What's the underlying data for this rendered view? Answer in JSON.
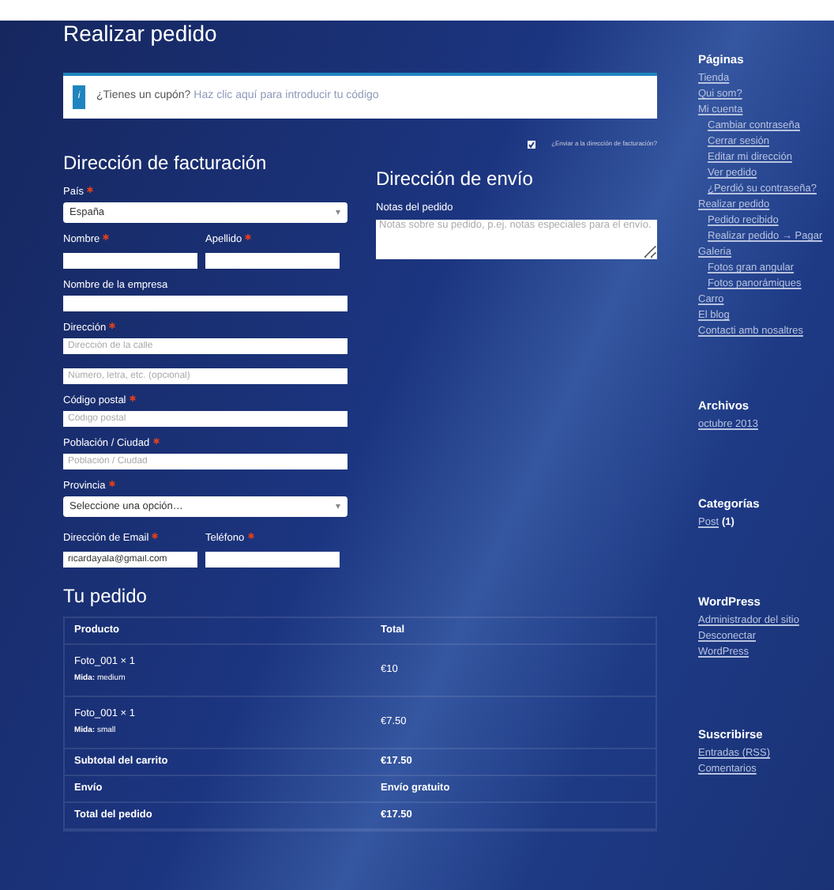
{
  "page_title": "Realizar pedido",
  "coupon": {
    "icon": "i",
    "text": "¿Tienes un cupón?",
    "link": "Haz clic aquí para introducir tu código"
  },
  "billing": {
    "heading": "Dirección de facturación",
    "fields": [
      {
        "kind": "select",
        "label": "País",
        "required": true,
        "value": "España"
      },
      {
        "kind": "pair",
        "items": [
          {
            "label": "Nombre",
            "required": true
          },
          {
            "label": "Apellido",
            "required": true
          }
        ]
      },
      {
        "kind": "text",
        "label": "Nombre de la empresa",
        "required": false
      },
      {
        "kind": "text",
        "label": "Dirección",
        "required": true,
        "placeholder": "Dirección de la calle"
      },
      {
        "kind": "text",
        "placeholder": "Número, letra, etc. (opcional)"
      },
      {
        "kind": "text",
        "label": "Código postal",
        "required": true,
        "placeholder": "Código postal"
      },
      {
        "kind": "text",
        "label": "Población / Ciudad",
        "required": true,
        "placeholder": "Población / Ciudad"
      },
      {
        "kind": "select",
        "label": "Provincia",
        "required": true,
        "value": "Seleccione una opción…"
      },
      {
        "kind": "pair",
        "items": [
          {
            "label": "Dirección de Email",
            "required": true,
            "value": "ricardayala@gmail.com"
          },
          {
            "label": "Teléfono",
            "required": true
          }
        ]
      }
    ]
  },
  "shipping": {
    "ship_to_billing": {
      "label": "¿Enviar a la dirección de facturación?",
      "checked": true
    },
    "heading": "Dirección de envío",
    "notes": {
      "label": "Notas del pedido",
      "placeholder": "Notas sobre su pedido, p.ej. notas especiales para el envío."
    }
  },
  "order": {
    "heading": "Tu pedido",
    "columns": [
      "Producto",
      "Total"
    ],
    "items": [
      {
        "name": "Foto_001 × 1",
        "meta_label": "Mida:",
        "meta_value": "medium",
        "total": "€10"
      },
      {
        "name": "Foto_001 × 1",
        "meta_label": "Mida:",
        "meta_value": "small",
        "total": "€7.50"
      }
    ],
    "totals": [
      {
        "label": "Subtotal del carrito",
        "value": "€17.50"
      },
      {
        "label": "Envío",
        "value": "Envío gratuito"
      },
      {
        "label": "Total del pedido",
        "value": "€17.50"
      }
    ]
  },
  "sidebar": [
    {
      "title": "Páginas",
      "links": [
        {
          "text": "Tienda"
        },
        {
          "text": "Qui som?"
        },
        {
          "text": "Mi cuenta",
          "children": [
            {
              "text": "Cambiar contraseña"
            },
            {
              "text": "Cerrar sesión"
            },
            {
              "text": "Editar mi dirección"
            },
            {
              "text": "Ver pedido"
            },
            {
              "text": "¿Perdió su contraseña?"
            }
          ]
        },
        {
          "text": "Realizar pedido",
          "children": [
            {
              "text": "Pedido recibido"
            },
            {
              "text": "Realizar pedido → Pagar"
            }
          ]
        },
        {
          "text": "Galeria",
          "children": [
            {
              "text": "Fotos gran angular"
            },
            {
              "text": "Fotos panorámiques"
            }
          ]
        },
        {
          "text": "Carro"
        },
        {
          "text": "El blog"
        },
        {
          "text": "Contacti amb nosaltres"
        }
      ]
    },
    {
      "title": "Archivos",
      "links": [
        {
          "text": "octubre 2013"
        }
      ]
    },
    {
      "title": "Categorías",
      "links": [
        {
          "text": "Post",
          "count": "(1)"
        }
      ]
    },
    {
      "title": "WordPress",
      "links": [
        {
          "text": "Administrador del sitio"
        },
        {
          "text": "Desconectar"
        },
        {
          "text": "WordPress"
        }
      ]
    },
    {
      "title": "Suscribirse",
      "links": [
        {
          "text": "Entradas (RSS)"
        },
        {
          "text": "Comentarios"
        }
      ]
    }
  ]
}
